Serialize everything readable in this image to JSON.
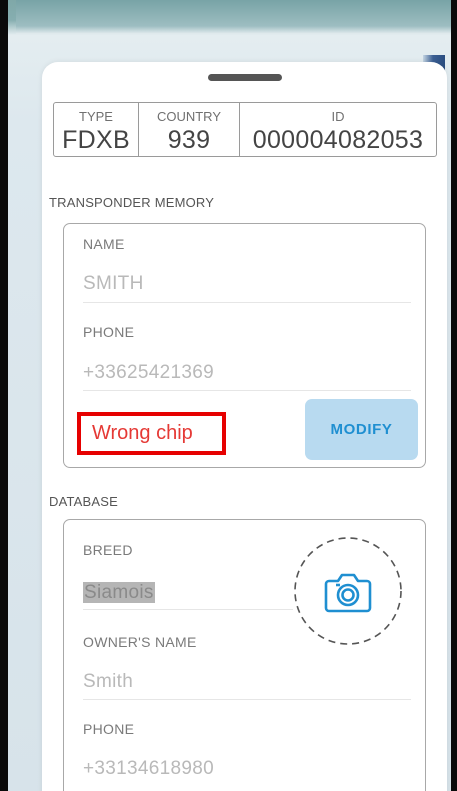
{
  "id_card": {
    "type_label": "TYPE",
    "type_value": "FDXB",
    "country_label": "COUNTRY",
    "country_value": "939",
    "id_label": "ID",
    "id_value": "000004082053"
  },
  "transponder_memory": {
    "title": "TRANSPONDER MEMORY",
    "name_label": "NAME",
    "name_value": "SMITH",
    "phone_label": "PHONE",
    "phone_value": "+33625421369",
    "status_text": "Wrong chip",
    "modify_label": "MODIFY"
  },
  "database": {
    "title": "DATABASE",
    "breed_label": "BREED",
    "breed_value": "Siamois",
    "owner_label": "OWNER'S NAME",
    "owner_value": "Smith",
    "phone_label": "PHONE",
    "phone_value": "+33134618980",
    "photo_icon": "camera-icon"
  },
  "colors": {
    "error": "#e53935",
    "accent": "#1f8fd1",
    "button_bg": "#b8daf0"
  }
}
